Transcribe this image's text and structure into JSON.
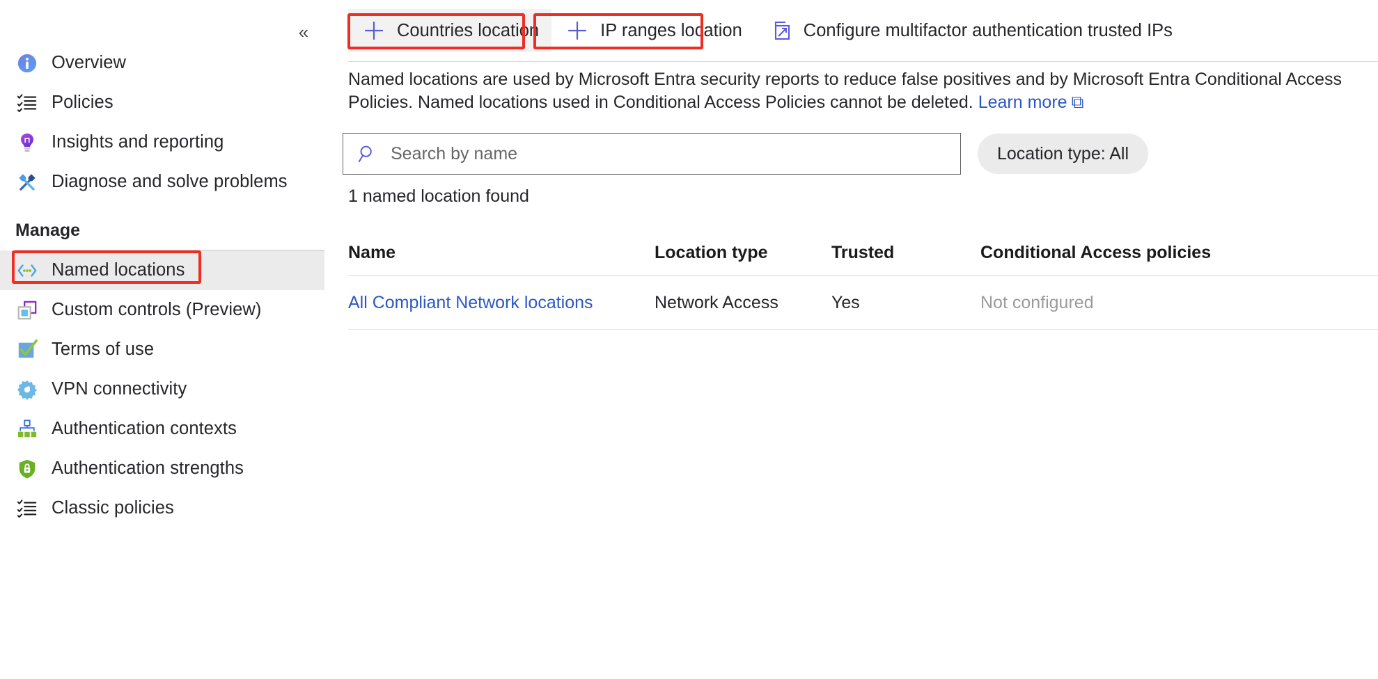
{
  "sidebar": {
    "collapse_glyph": "«",
    "items": [
      {
        "label": "Overview",
        "icon": "info-circle-icon",
        "selected": false
      },
      {
        "label": "Policies",
        "icon": "checklist-icon",
        "selected": false
      },
      {
        "label": "Insights and reporting",
        "icon": "lightbulb-icon",
        "selected": false
      },
      {
        "label": "Diagnose and solve problems",
        "icon": "wrench-screwdriver-icon",
        "selected": false
      }
    ],
    "group_title": "Manage",
    "manage_items": [
      {
        "label": "Named locations",
        "icon": "named-locations-icon",
        "selected": true
      },
      {
        "label": "Custom controls (Preview)",
        "icon": "custom-controls-icon",
        "selected": false
      },
      {
        "label": "Terms of use",
        "icon": "checkbox-checked-icon",
        "selected": false
      },
      {
        "label": "VPN connectivity",
        "icon": "gear-icon",
        "selected": false
      },
      {
        "label": "Authentication contexts",
        "icon": "hierarchy-icon",
        "selected": false
      },
      {
        "label": "Authentication strengths",
        "icon": "shield-lock-icon",
        "selected": false
      },
      {
        "label": "Classic policies",
        "icon": "checklist-icon",
        "selected": false
      }
    ]
  },
  "toolbar": {
    "commands": [
      {
        "label": "Countries location",
        "icon": "plus-icon",
        "hovered": true
      },
      {
        "label": "IP ranges location",
        "icon": "plus-icon",
        "hovered": false
      },
      {
        "label": "Configure multifactor authentication trusted IPs",
        "icon": "external-link-icon",
        "hovered": false
      }
    ]
  },
  "description": {
    "line1_before_link": "Named locations are used by Microsoft Entra security reports to reduce false positives and by Microsoft Entra Conditional Access Policies. Named locations used in Conditional Access Policies cannot be deleted.",
    "learn_more": "Learn more",
    "learn_more_glyph": "⧉"
  },
  "search": {
    "placeholder": "Search by name",
    "value": "",
    "icon": "search-icon"
  },
  "filter": {
    "pill_label": "Location type: All"
  },
  "results": {
    "count_text": "1 named location found"
  },
  "table": {
    "columns": [
      "Name",
      "Location type",
      "Trusted",
      "Conditional Access policies"
    ],
    "rows": [
      {
        "name": "All Compliant Network locations",
        "location_type": "Network Access",
        "trusted": "Yes",
        "conditional_access": "Not configured"
      }
    ]
  },
  "colors": {
    "annotation": "#ee2d24",
    "link": "#2c58c4",
    "accent": "#5b5bd6",
    "selected_nav_bg": "#ebebeb"
  }
}
